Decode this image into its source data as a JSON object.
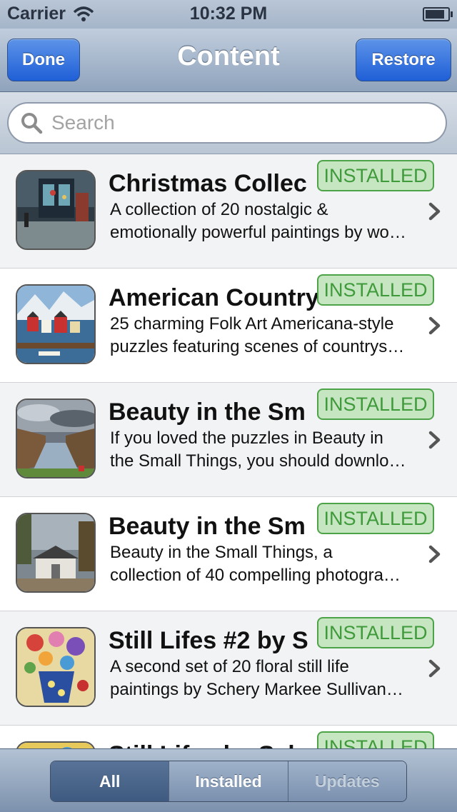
{
  "status_bar": {
    "carrier": "Carrier",
    "time": "10:32 PM"
  },
  "nav": {
    "title": "Content",
    "left_button": "Done",
    "right_button": "Restore"
  },
  "search": {
    "placeholder": "Search"
  },
  "items": [
    {
      "title": "Christmas Collec",
      "line1": "A collection of 20 nostalgic &",
      "line2": "emotionally powerful paintings by wo…",
      "badge": "INSTALLED"
    },
    {
      "title": "American Country",
      "line1": "25 charming Folk Art Americana-style",
      "line2": "puzzles featuring scenes of countrys…",
      "badge": "INSTALLED"
    },
    {
      "title": "Beauty in the Sm",
      "line1": "If you loved the puzzles in Beauty in",
      "line2": "the Small Things, you should downlo…",
      "badge": "INSTALLED"
    },
    {
      "title": "Beauty in the Sm",
      "line1": "Beauty in the Small Things, a",
      "line2": "collection of 40 compelling photogra…",
      "badge": "INSTALLED"
    },
    {
      "title": "Still Lifes #2 by S",
      "line1": "A second set of 20 floral still life",
      "line2": "paintings by Schery Markee Sullivan…",
      "badge": "INSTALLED"
    },
    {
      "title": "Still Lifes by Sch",
      "line1": "",
      "line2": "",
      "badge": "INSTALLED"
    }
  ],
  "tabs": {
    "all": "All",
    "installed": "Installed",
    "updates": "Updates",
    "selected": "All"
  },
  "colors": {
    "accent": "#2a67dc",
    "installed_green": "#3f9a3b",
    "installed_bg": "#c6e6c1"
  }
}
